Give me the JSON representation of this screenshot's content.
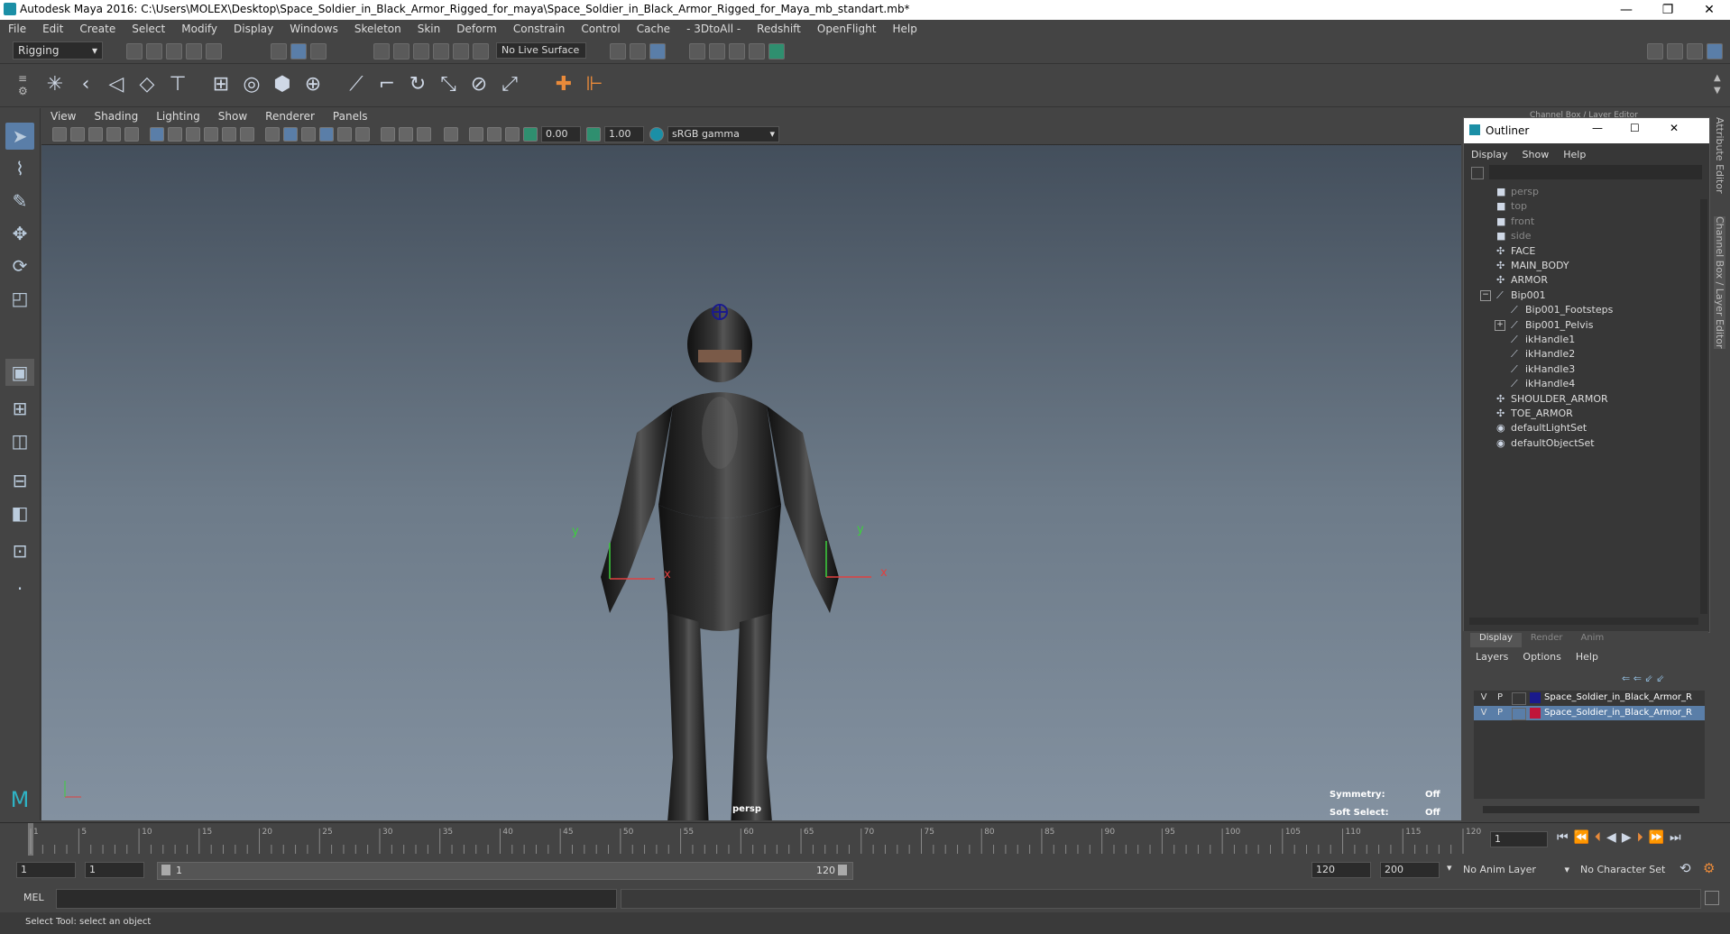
{
  "window": {
    "title": "Autodesk Maya 2016: C:\\Users\\MOLEX\\Desktop\\Space_Soldier_in_Black_Armor_Rigged_for_maya\\Space_Soldier_in_Black_Armor_Rigged_for_Maya_mb_standart.mb*",
    "minimize": "—",
    "restore": "❐",
    "close": "✕"
  },
  "menubar": [
    "File",
    "Edit",
    "Create",
    "Select",
    "Modify",
    "Display",
    "Windows",
    "Skeleton",
    "Skin",
    "Deform",
    "Constrain",
    "Control",
    "Cache",
    "- 3DtoAll -",
    "Redshift",
    "OpenFlight",
    "Help"
  ],
  "statusline": {
    "menuset": "Rigging",
    "live_surface": "No Live Surface"
  },
  "viewport": {
    "menus": [
      "View",
      "Shading",
      "Lighting",
      "Show",
      "Renderer",
      "Panels"
    ],
    "exposure": "0.00",
    "gamma": "1.00",
    "colorspace": "sRGB gamma",
    "camera_label": "persp",
    "symmetry_label": "Symmetry:",
    "symmetry_value": "Off",
    "softselect_label": "Soft Select:",
    "softselect_value": "Off",
    "axis_x": "x",
    "axis_y": "y"
  },
  "channel_box_label": "Channel Box / Layer Editor",
  "outliner": {
    "title": "Outliner",
    "menus": [
      "Display",
      "Show",
      "Help"
    ],
    "items": [
      {
        "label": "persp",
        "indent": 0,
        "dim": true,
        "icon": "camera-icon"
      },
      {
        "label": "top",
        "indent": 0,
        "dim": true,
        "icon": "camera-icon"
      },
      {
        "label": "front",
        "indent": 0,
        "dim": true,
        "icon": "camera-icon"
      },
      {
        "label": "side",
        "indent": 0,
        "dim": true,
        "icon": "camera-icon"
      },
      {
        "label": "FACE",
        "indent": 0,
        "dim": false,
        "icon": "group-icon"
      },
      {
        "label": "MAIN_BODY",
        "indent": 0,
        "dim": false,
        "icon": "group-icon"
      },
      {
        "label": "ARMOR",
        "indent": 0,
        "dim": false,
        "icon": "group-icon"
      },
      {
        "label": "Bip001",
        "indent": 0,
        "dim": false,
        "icon": "joint-icon",
        "expander": "−"
      },
      {
        "label": "Bip001_Footsteps",
        "indent": 1,
        "dim": false,
        "icon": "joint-icon"
      },
      {
        "label": "Bip001_Pelvis",
        "indent": 1,
        "dim": false,
        "icon": "joint-icon",
        "expander": "+"
      },
      {
        "label": "ikHandle1",
        "indent": 1,
        "dim": false,
        "icon": "ik-handle-icon"
      },
      {
        "label": "ikHandle2",
        "indent": 1,
        "dim": false,
        "icon": "ik-handle-icon"
      },
      {
        "label": "ikHandle3",
        "indent": 1,
        "dim": false,
        "icon": "ik-handle-icon"
      },
      {
        "label": "ikHandle4",
        "indent": 1,
        "dim": false,
        "icon": "ik-handle-icon"
      },
      {
        "label": "SHOULDER_ARMOR",
        "indent": 0,
        "dim": false,
        "icon": "group-icon"
      },
      {
        "label": "TOE_ARMOR",
        "indent": 0,
        "dim": false,
        "icon": "group-icon"
      },
      {
        "label": "defaultLightSet",
        "indent": 0,
        "dim": false,
        "icon": "set-icon"
      },
      {
        "label": "defaultObjectSet",
        "indent": 0,
        "dim": false,
        "icon": "set-icon"
      }
    ]
  },
  "layer_editor": {
    "tabs": [
      "Display",
      "Render",
      "Anim"
    ],
    "menus": [
      "Layers",
      "Options",
      "Help"
    ],
    "layers": [
      {
        "v": "V",
        "p": "P",
        "name": "Space_Soldier_in_Black_Armor_R",
        "color": "#1a1a8c",
        "selected": false
      },
      {
        "v": "V",
        "p": "P",
        "name": "Space_Soldier_in_Black_Armor_R",
        "color": "#c0163a",
        "selected": true
      }
    ]
  },
  "timeline": {
    "ticks": [
      "1",
      "5",
      "10",
      "15",
      "20",
      "25",
      "30",
      "35",
      "40",
      "45",
      "50",
      "55",
      "60",
      "65",
      "70",
      "75",
      "80",
      "85",
      "90",
      "95",
      "100",
      "105",
      "110",
      "115",
      "120"
    ],
    "current_frame": "1"
  },
  "range": {
    "start": "1",
    "playback_start": "1",
    "slider_start": "1",
    "slider_end": "120",
    "playback_end": "120",
    "end": "200",
    "anim_layer": "No Anim Layer",
    "character_set": "No Character Set"
  },
  "command": {
    "lang": "MEL"
  },
  "help": {
    "text": "Select Tool: select an object"
  },
  "right_strip": {
    "attribute_editor": "Attribute Editor",
    "channel_box": "Channel Box / Layer Editor"
  }
}
